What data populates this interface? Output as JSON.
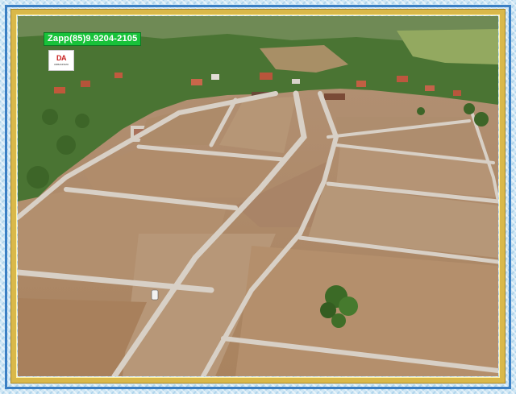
{
  "overlay": {
    "phone_text": "Zapp(85)9.9204-2105",
    "logo_mark": "DA",
    "logo_subtext": "URBANISMO"
  },
  "colors": {
    "frame_blue": "#3a7fc4",
    "frame_gold": "#d9b84a",
    "banner_green": "#18c23a",
    "soil": "#b48f6c",
    "road": "#d6cfc6",
    "vegetation": "#3f6b2a"
  },
  "scene": {
    "type": "aerial photograph",
    "features": [
      "vegetation",
      "houses",
      "dirt-lots",
      "roads",
      "tree",
      "car"
    ]
  }
}
